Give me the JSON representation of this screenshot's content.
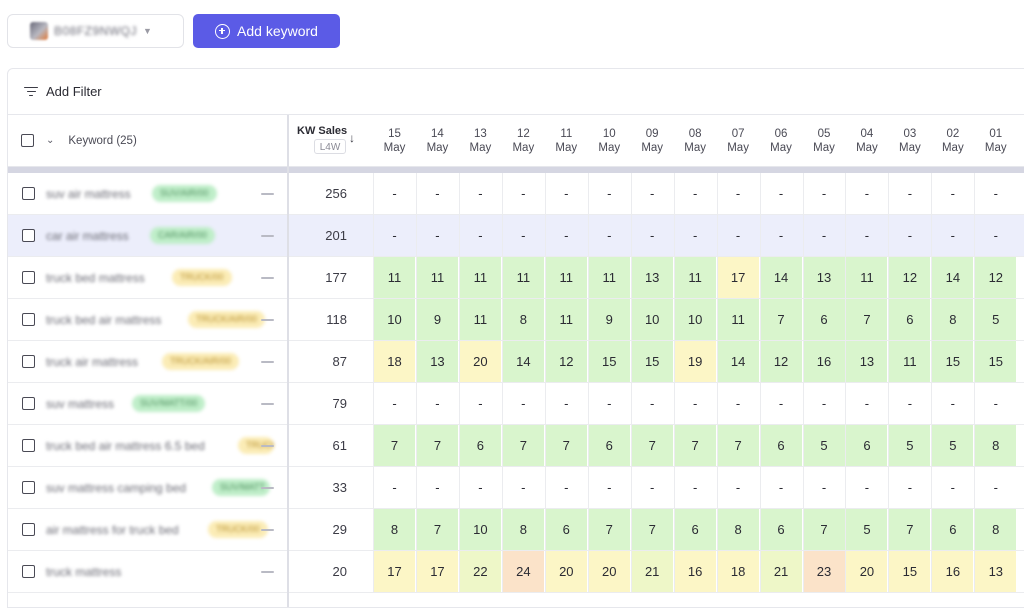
{
  "product_selector": {
    "asin": "B08FZ9NWQJ",
    "thumbnail": "product-thumbnail"
  },
  "add_keyword_label": "Add keyword",
  "add_filter_label": "Add Filter",
  "table": {
    "keyword_header": "Keyword (25)",
    "sales_header": "KW Sales",
    "sales_subheader": "L4W",
    "dates": [
      {
        "d": "15",
        "m": "May"
      },
      {
        "d": "14",
        "m": "May"
      },
      {
        "d": "13",
        "m": "May"
      },
      {
        "d": "12",
        "m": "May"
      },
      {
        "d": "11",
        "m": "May"
      },
      {
        "d": "10",
        "m": "May"
      },
      {
        "d": "09",
        "m": "May"
      },
      {
        "d": "08",
        "m": "May"
      },
      {
        "d": "07",
        "m": "May"
      },
      {
        "d": "06",
        "m": "May"
      },
      {
        "d": "05",
        "m": "May"
      },
      {
        "d": "04",
        "m": "May"
      },
      {
        "d": "03",
        "m": "May"
      },
      {
        "d": "02",
        "m": "May"
      },
      {
        "d": "01",
        "m": "May"
      }
    ],
    "rows": [
      {
        "keyword": "suv air mattress",
        "tag": "SUV/AIR/00",
        "tag_color": "green",
        "sales": "256",
        "selected": false,
        "ranks": [
          "-",
          "-",
          "-",
          "-",
          "-",
          "-",
          "-",
          "-",
          "-",
          "-",
          "-",
          "-",
          "-",
          "-",
          "-"
        ],
        "shades": [
          "",
          "",
          "",
          "",
          "",
          "",
          "",
          "",
          "",
          "",
          "",
          "",
          "",
          "",
          ""
        ]
      },
      {
        "keyword": "car air mattress",
        "tag": "CAR/AIR/00",
        "tag_color": "green",
        "sales": "201",
        "selected": true,
        "ranks": [
          "-",
          "-",
          "-",
          "-",
          "-",
          "-",
          "-",
          "-",
          "-",
          "-",
          "-",
          "-",
          "-",
          "-",
          "-"
        ],
        "shades": [
          "",
          "",
          "",
          "",
          "",
          "",
          "",
          "",
          "",
          "",
          "",
          "",
          "",
          "",
          ""
        ]
      },
      {
        "keyword": "truck bed mattress",
        "tag": "TRUCK/00",
        "tag_color": "yellow",
        "sales": "177",
        "selected": false,
        "ranks": [
          "11",
          "11",
          "11",
          "11",
          "11",
          "11",
          "13",
          "11",
          "17",
          "14",
          "13",
          "11",
          "12",
          "14",
          "12"
        ],
        "shades": [
          "g",
          "g",
          "g",
          "g",
          "g",
          "g",
          "g",
          "g",
          "y",
          "g",
          "g",
          "g",
          "g",
          "g",
          "g"
        ]
      },
      {
        "keyword": "truck bed air mattress",
        "tag": "TRUCK/AIR/00",
        "tag_color": "yellow",
        "sales": "118",
        "selected": false,
        "ranks": [
          "10",
          "9",
          "11",
          "8",
          "11",
          "9",
          "10",
          "10",
          "11",
          "7",
          "6",
          "7",
          "6",
          "8",
          "5"
        ],
        "shades": [
          "g",
          "g",
          "g",
          "g",
          "g",
          "g",
          "g",
          "g",
          "g",
          "g",
          "g",
          "g",
          "g",
          "g",
          "g"
        ]
      },
      {
        "keyword": "truck air mattress",
        "tag": "TRUCK/AIR/00",
        "tag_color": "yellow",
        "sales": "87",
        "selected": false,
        "ranks": [
          "18",
          "13",
          "20",
          "14",
          "12",
          "15",
          "15",
          "19",
          "14",
          "12",
          "16",
          "13",
          "11",
          "15",
          "15"
        ],
        "shades": [
          "y",
          "g",
          "y",
          "g",
          "g",
          "g",
          "g",
          "y",
          "g",
          "g",
          "g",
          "g",
          "g",
          "g",
          "g"
        ]
      },
      {
        "keyword": "suv mattress",
        "tag": "SUV/MATT/00",
        "tag_color": "green",
        "sales": "79",
        "selected": false,
        "ranks": [
          "-",
          "-",
          "-",
          "-",
          "-",
          "-",
          "-",
          "-",
          "-",
          "-",
          "-",
          "-",
          "-",
          "-",
          "-"
        ],
        "shades": [
          "",
          "",
          "",
          "",
          "",
          "",
          "",
          "",
          "",
          "",
          "",
          "",
          "",
          "",
          ""
        ]
      },
      {
        "keyword": "truck bed air mattress 6.5 bed",
        "tag": "TRUCK",
        "tag_color": "yellow",
        "sales": "61",
        "selected": false,
        "ranks": [
          "7",
          "7",
          "6",
          "7",
          "7",
          "6",
          "7",
          "7",
          "7",
          "6",
          "5",
          "6",
          "5",
          "5",
          "8"
        ],
        "shades": [
          "g",
          "g",
          "g",
          "g",
          "g",
          "g",
          "g",
          "g",
          "g",
          "g",
          "g",
          "g",
          "g",
          "g",
          "g"
        ]
      },
      {
        "keyword": "suv mattress camping bed",
        "tag": "SUV/MATT",
        "tag_color": "green",
        "sales": "33",
        "selected": false,
        "ranks": [
          "-",
          "-",
          "-",
          "-",
          "-",
          "-",
          "-",
          "-",
          "-",
          "-",
          "-",
          "-",
          "-",
          "-",
          "-"
        ],
        "shades": [
          "",
          "",
          "",
          "",
          "",
          "",
          "",
          "",
          "",
          "",
          "",
          "",
          "",
          "",
          ""
        ]
      },
      {
        "keyword": "air mattress for truck bed",
        "tag": "TRUCK/00",
        "tag_color": "yellow",
        "sales": "29",
        "selected": false,
        "ranks": [
          "8",
          "7",
          "10",
          "8",
          "6",
          "7",
          "7",
          "6",
          "8",
          "6",
          "7",
          "5",
          "7",
          "6",
          "8"
        ],
        "shades": [
          "g",
          "g",
          "g",
          "g",
          "g",
          "g",
          "g",
          "g",
          "g",
          "g",
          "g",
          "g",
          "g",
          "g",
          "g"
        ]
      },
      {
        "keyword": "truck mattress",
        "tag": "",
        "tag_color": "",
        "sales": "20",
        "selected": false,
        "ranks": [
          "17",
          "17",
          "22",
          "24",
          "20",
          "20",
          "21",
          "16",
          "18",
          "21",
          "23",
          "20",
          "15",
          "16",
          "13"
        ],
        "shades": [
          "y",
          "y",
          "l",
          "o",
          "y",
          "y",
          "l",
          "y",
          "y",
          "l",
          "o",
          "y",
          "y",
          "y",
          "y"
        ]
      }
    ]
  },
  "colors": {
    "accent": "#5b5be6",
    "green": "#d9f5cd",
    "yellow": "#fcf6c6",
    "orange": "#fbe3c9",
    "selected_row": "#eceefb"
  }
}
